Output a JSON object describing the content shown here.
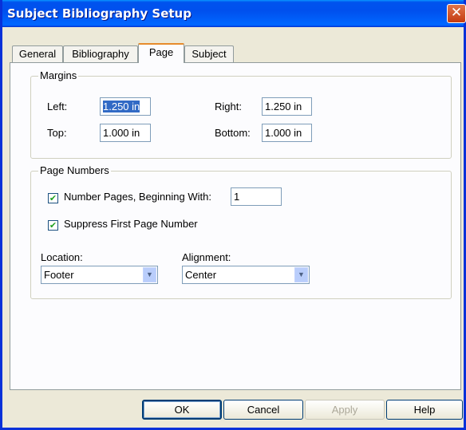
{
  "window": {
    "title": "Subject Bibliography Setup",
    "close_glyph": "✕"
  },
  "tabs": [
    {
      "label": "General"
    },
    {
      "label": "Bibliography"
    },
    {
      "label": "Page"
    },
    {
      "label": "Subject"
    }
  ],
  "active_tab": "Page",
  "margins": {
    "group_label": "Margins",
    "left_label": "Left:",
    "left_value": "1.250 in",
    "right_label": "Right:",
    "right_value": "1.250 in",
    "top_label": "Top:",
    "top_value": "1.000 in",
    "bottom_label": "Bottom:",
    "bottom_value": "1.000 in"
  },
  "page_numbers": {
    "group_label": "Page Numbers",
    "number_pages_label": "Number Pages, Beginning With:",
    "number_pages_checked": true,
    "begin_value": "1",
    "suppress_label": "Suppress First Page Number",
    "suppress_checked": true,
    "check_glyph": "✔",
    "location_label": "Location:",
    "location_value": "Footer",
    "alignment_label": "Alignment:",
    "alignment_value": "Center",
    "arrow_glyph": "▼"
  },
  "buttons": {
    "ok": "OK",
    "cancel": "Cancel",
    "apply": "Apply",
    "help": "Help"
  },
  "colors": {
    "titlebar": "#0053ee",
    "active_tab_accent": "#e68b2c",
    "selection": "#316ac5"
  }
}
